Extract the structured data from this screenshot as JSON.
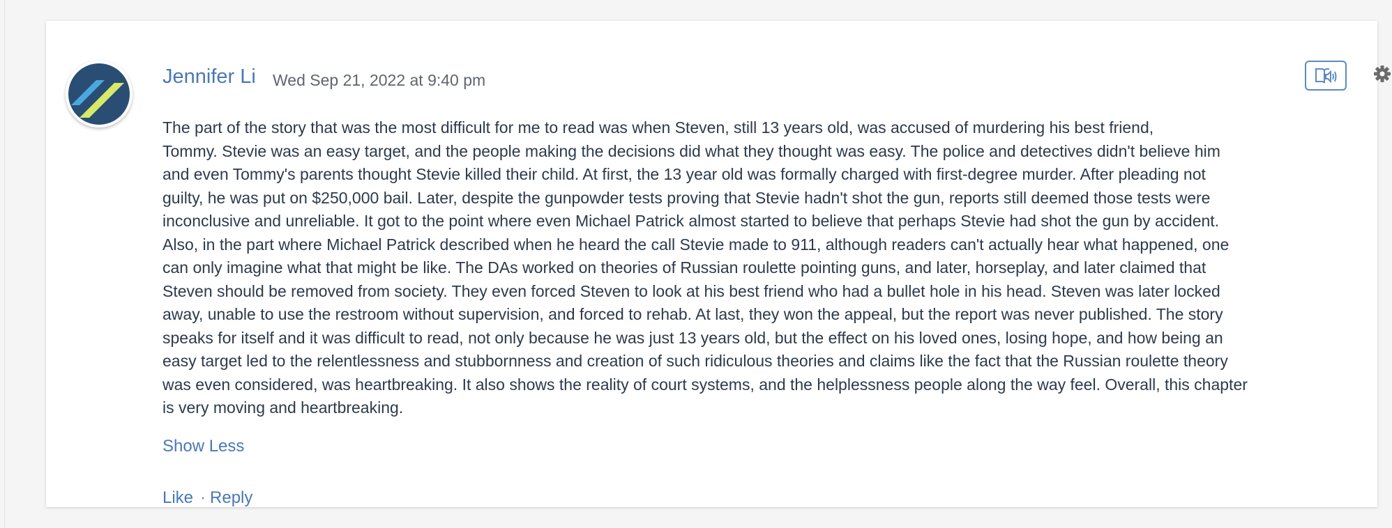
{
  "post": {
    "author": "Jennifer Li",
    "timestamp": "Wed Sep 21, 2022 at 9:40 pm",
    "avatar_icon": "striped-avatar-icon",
    "colors": {
      "link": "#4a78b5",
      "avatar_bg": "#2a4e73",
      "avatar_stripe_blue": "#4aa8df",
      "avatar_stripe_green": "#d6e96a"
    },
    "body_lines": [
      "The part of the story that was the most difficult for me to read was when Steven, still 13 years old, was accused of murdering his best friend,",
      "Tommy. Stevie was an easy target, and the people making the decisions did what they thought was easy. The police and detectives didn't believe him",
      "and even Tommy's parents thought Stevie killed their child. At first, the 13 year old was formally charged with first-degree murder. After pleading not",
      "guilty, he was put on $250,000 bail. Later, despite the gunpowder tests proving that Stevie hadn't shot the gun, reports still deemed those tests were",
      "inconclusive and unreliable. It got to the point where even Michael Patrick almost started to believe that perhaps Stevie had shot the gun by accident.",
      "Also, in the part where Michael Patrick described when he heard the call Stevie made to 911, although readers can't actually hear what happened, one",
      "can only imagine what that might be like. The DAs worked on theories of Russian roulette pointing guns, and later, horseplay, and later claimed that",
      "Steven should be removed from society. They even forced Steven to look at his best friend who had a bullet hole in his head. Steven was later locked",
      "away, unable to use the restroom without supervision, and forced to rehab. At last, they won the appeal, but the report was never published. The story",
      "speaks for itself and it was difficult to read, not only because he was just 13 years old, but the effect on his loved ones, losing hope, and how being an",
      "easy target led to the relentlessness and stubbornness and creation of such ridiculous theories and claims like the fact that the Russian roulette theory",
      "was even considered, was heartbreaking. It also shows the reality of court systems, and the helplessness people along the way feel. Overall, this chapter",
      "is very moving and heartbreaking."
    ],
    "show_less_label": "Show Less",
    "like_label": "Like",
    "separator": "·",
    "reply_label": "Reply"
  },
  "toolbar": {
    "audio_icon": "immersive-reader-icon",
    "settings_icon": "gear-icon",
    "dropdown_icon": "caret-down-icon"
  }
}
